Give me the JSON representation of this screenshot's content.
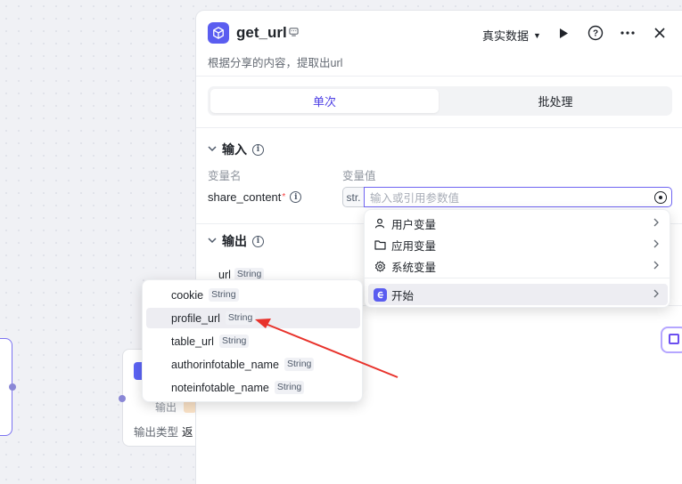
{
  "canvas": {
    "node_output_label": "输出",
    "node_output_type_label": "输出类型",
    "node_output_type_value": "返"
  },
  "panel": {
    "title": "get_url",
    "description": "根据分享的内容，提取出url",
    "data_mode": "真实数据",
    "tabs": [
      {
        "label": "单次",
        "active": true
      },
      {
        "label": "批处理",
        "active": false
      }
    ],
    "input": {
      "section_title": "输入",
      "col_name": "变量名",
      "col_value": "变量值",
      "var_name": "share_content",
      "required_mark": "*",
      "type_badge": "str.",
      "placeholder": "输入或引用参数值"
    },
    "output": {
      "section_title": "输出",
      "field_name": "url",
      "field_type": "String"
    }
  },
  "ref_menu": {
    "items": [
      {
        "label": "用户变量",
        "icon": "user-icon"
      },
      {
        "label": "应用变量",
        "icon": "folder-icon"
      },
      {
        "label": "系统变量",
        "icon": "gear-icon"
      }
    ],
    "start_label": "开始"
  },
  "sub_menu": {
    "items": [
      {
        "name": "cookie",
        "type": "String"
      },
      {
        "name": "profile_url",
        "type": "String"
      },
      {
        "name": "table_url",
        "type": "String"
      },
      {
        "name": "authorinfotable_name",
        "type": "String"
      },
      {
        "name": "noteinfotable_name",
        "type": "String"
      }
    ]
  },
  "colors": {
    "accent": "#4e40e5",
    "annotation_arrow": "#e8322b"
  }
}
